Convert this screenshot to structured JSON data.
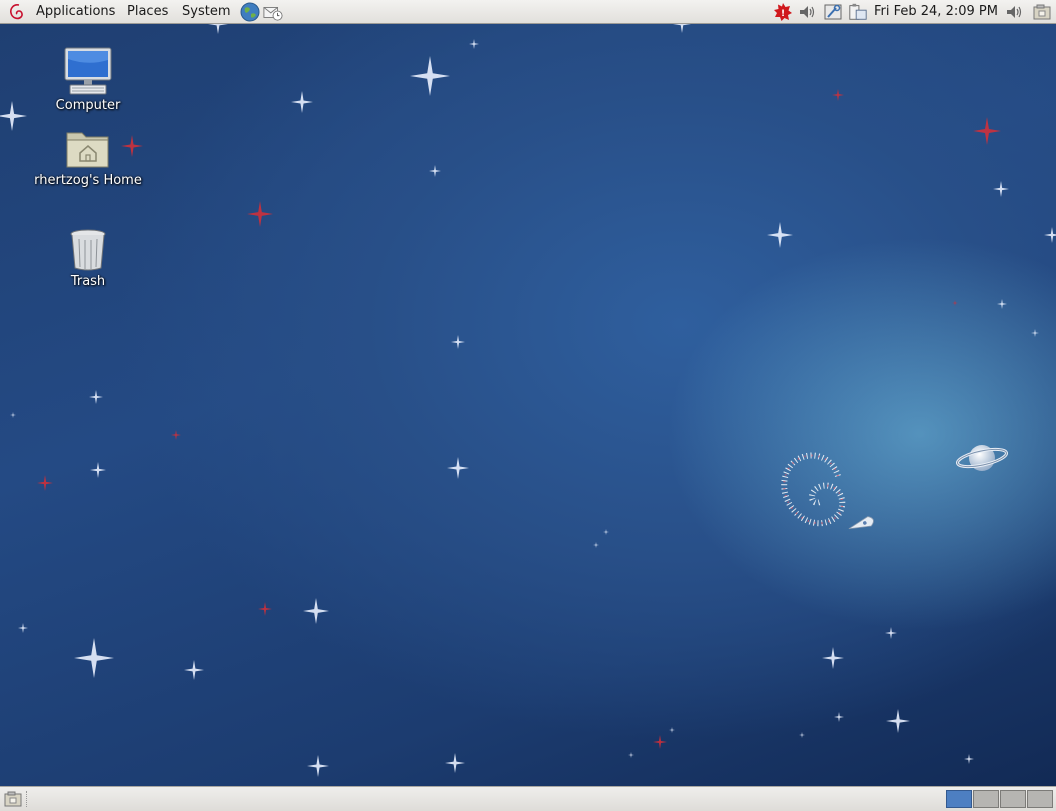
{
  "top_panel": {
    "menus": {
      "applications": "Applications",
      "places": "Places",
      "system": "System"
    },
    "launchers": [
      "web-browser-icon",
      "mail-client-icon"
    ],
    "tray": [
      "update-notification-icon",
      "volume-icon",
      "network-tool-icon",
      "clipboard-icon"
    ],
    "clock": "Fri Feb 24,  2:09 PM",
    "right_icons": [
      "volume-control-icon",
      "show-desktop-icon"
    ]
  },
  "desktop": {
    "icons": {
      "computer": "Computer",
      "home": "rhertzog's Home",
      "trash": "Trash"
    }
  },
  "bottom_panel": {
    "workspaces": {
      "count": 4,
      "active": 1
    }
  },
  "colors": {
    "panel": "#e8e6e2",
    "desktop_blue": "#244a84",
    "active_workspace": "#4d7fc2"
  }
}
